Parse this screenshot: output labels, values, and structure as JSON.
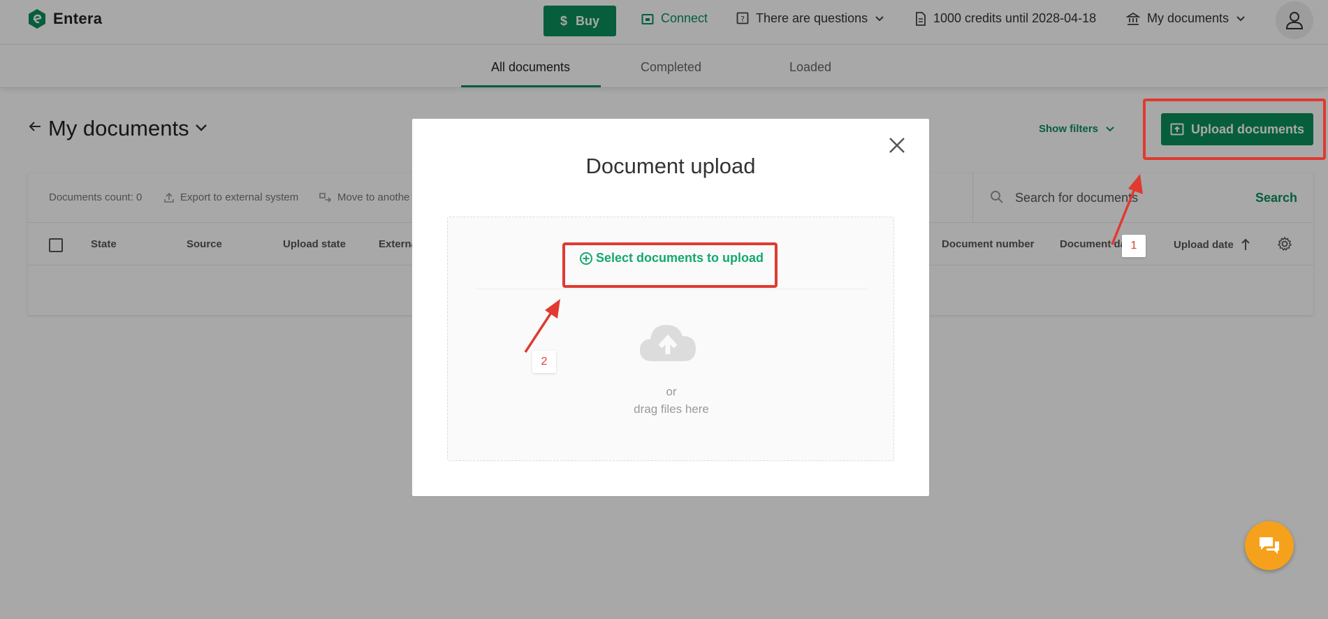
{
  "app": {
    "name": "Entera",
    "logo_icon": "entera-logo-icon"
  },
  "header": {
    "buy_label": "Buy",
    "connect_label": "Connect",
    "questions_label": "There are questions",
    "credits_label": "1000 credits until 2028-04-18",
    "mydocs_label": "My documents"
  },
  "tabs": [
    {
      "label": "All documents",
      "active": true
    },
    {
      "label": "Completed",
      "active": false
    },
    {
      "label": "Loaded",
      "active": false
    }
  ],
  "page": {
    "title": "My documents",
    "show_filters_label": "Show filters",
    "upload_label": "Upload documents"
  },
  "toolbar": {
    "count_label": "Documents count: 0",
    "export_label": "Export to external system",
    "move_label": "Move to anothe"
  },
  "search": {
    "placeholder": "Search for documents",
    "button_label": "Search"
  },
  "table": {
    "columns": [
      "State",
      "Source",
      "Upload state",
      "Externa",
      "Document number",
      "Document da",
      "Upload date"
    ]
  },
  "modal": {
    "title": "Document upload",
    "select_label": "Select documents to upload",
    "or_label": "or",
    "drag_label": "drag files here"
  },
  "annotations": {
    "step1": "1",
    "step2": "2"
  },
  "colors": {
    "brand_green": "#0a8f5c",
    "link_green": "#15a870",
    "highlight_red": "#e03a31",
    "chat_orange": "#f6a11b"
  }
}
